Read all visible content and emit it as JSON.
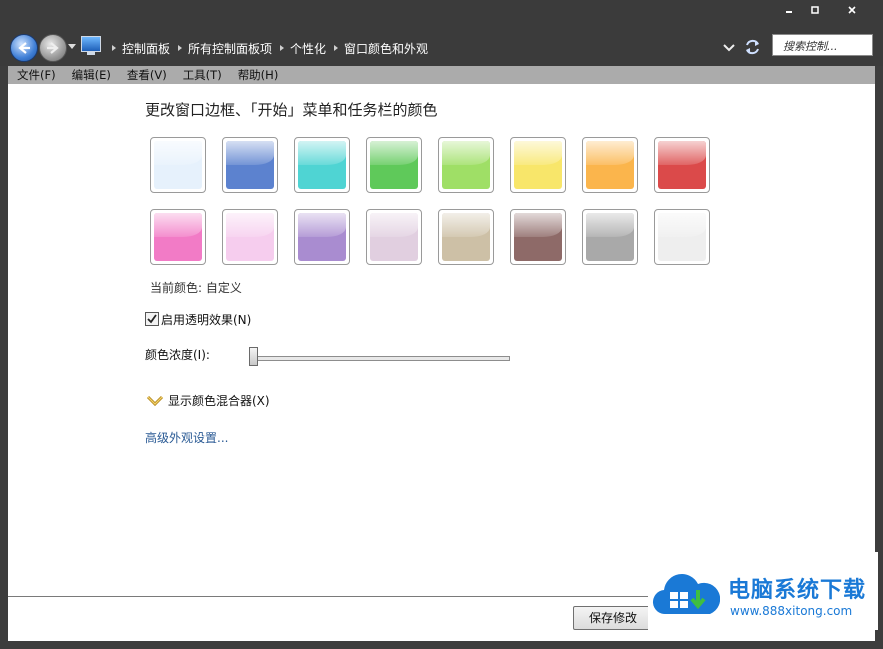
{
  "window": {
    "minimize_glyph": "▪",
    "maximize_glyph": "□",
    "close_glyph": "✕"
  },
  "address": {
    "breadcrumbs": [
      "控制面板",
      "所有控制面板项",
      "个性化",
      "窗口颜色和外观"
    ],
    "search_placeholder": "搜索控制..."
  },
  "menu": [
    "文件(F)",
    "编辑(E)",
    "查看(V)",
    "工具(T)",
    "帮助(H)"
  ],
  "main": {
    "heading": "更改窗口边框、「开始」菜单和任务栏的颜色",
    "swatch_colors": [
      [
        "#e6f1fc",
        "#5c82cf",
        "#4fd4d3",
        "#5fc95a",
        "#9fdf66",
        "#f8e66a",
        "#fbb54c",
        "#db4a4a"
      ],
      [
        "#f27bc6",
        "#f6cdee",
        "#a98cd0",
        "#e1cfe0",
        "#cdc0a6",
        "#8e6a68",
        "#a9a9a9",
        "#eeeeee"
      ]
    ],
    "current_color_label": "当前颜色: 自定义",
    "transparency_label": "启用透明效果(N)",
    "transparency_checked": true,
    "intensity_label": "颜色浓度(I):",
    "intensity_value": 0,
    "mixer_label": "显示颜色混合器(X)",
    "advanced_link": "高级外观设置..."
  },
  "footer": {
    "save_label": "保存修改"
  },
  "watermark": {
    "title": "电脑系统下载",
    "url": "www.888xitong.com"
  }
}
